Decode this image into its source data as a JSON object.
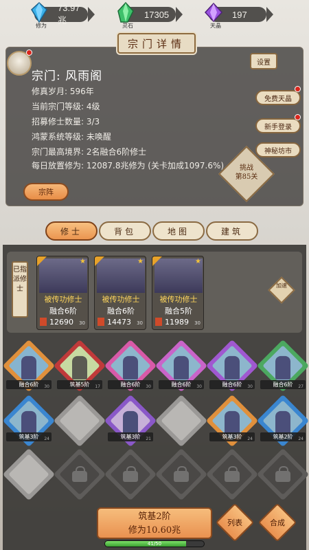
{
  "resources": [
    {
      "value": "73.97兆",
      "caption": "修为",
      "color": "#3ab0e8",
      "icon": "spirit-crystal-icon"
    },
    {
      "value": "17305",
      "caption": "灵石",
      "color": "#3ec06a",
      "icon": "spirit-stone-icon"
    },
    {
      "value": "197",
      "caption": "天晶",
      "color": "#9a52e0",
      "icon": "heaven-crystal-icon"
    }
  ],
  "panel": {
    "title": "宗门详情",
    "sect_name": "宗门: 风雨阁",
    "rows": [
      "修真岁月: 596年",
      "当前宗门等级: 4级",
      "招募修士数量: 3/3",
      "鸿蒙系统等级: 未唤醒",
      "宗门最高境界: 2名融合6阶修士",
      "每日放置修为: 12087.8兆修为 (关卡加成1097.6%)"
    ],
    "settings": "设置",
    "side_buttons": [
      "免费天晶",
      "新手登录",
      "神秘坊市"
    ],
    "challenge": [
      "挑战",
      "第85关"
    ],
    "sect_button": "宗阵"
  },
  "tabs": [
    "修士",
    "背包",
    "地图",
    "建筑"
  ],
  "dispatched": {
    "label": "已指派修士",
    "speedup": "加速",
    "cards": [
      {
        "name": "被传功修士",
        "level": "融合6阶",
        "power": "12690",
        "small": "30"
      },
      {
        "name": "被传功修士",
        "level": "融合6阶",
        "power": "14473",
        "small": "30"
      },
      {
        "name": "被传功修士",
        "level": "融合5阶",
        "power": "11989",
        "small": "30"
      }
    ]
  },
  "grid_labels": [
    {
      "text": "融合6阶",
      "n": "30"
    },
    {
      "text": "筑基5阶",
      "n": "17"
    },
    {
      "text": "融合6阶",
      "n": "30"
    },
    {
      "text": "融合6阶",
      "n": "30"
    },
    {
      "text": "融合6阶",
      "n": "30"
    },
    {
      "text": "融合6阶",
      "n": "27"
    },
    {
      "text": "筑基3阶",
      "n": "24"
    },
    {
      "text": "筑基3阶",
      "n": "21"
    },
    {
      "text": "筑基3阶",
      "n": "24"
    },
    {
      "text": "筑基2阶",
      "n": "24"
    }
  ],
  "bottom": {
    "main_line1": "筑基2阶",
    "main_line2": "修为10.60兆",
    "left_btn": "列表",
    "right_btn": "合成",
    "progress_text": "41/50",
    "progress_fraction": 0.82
  }
}
